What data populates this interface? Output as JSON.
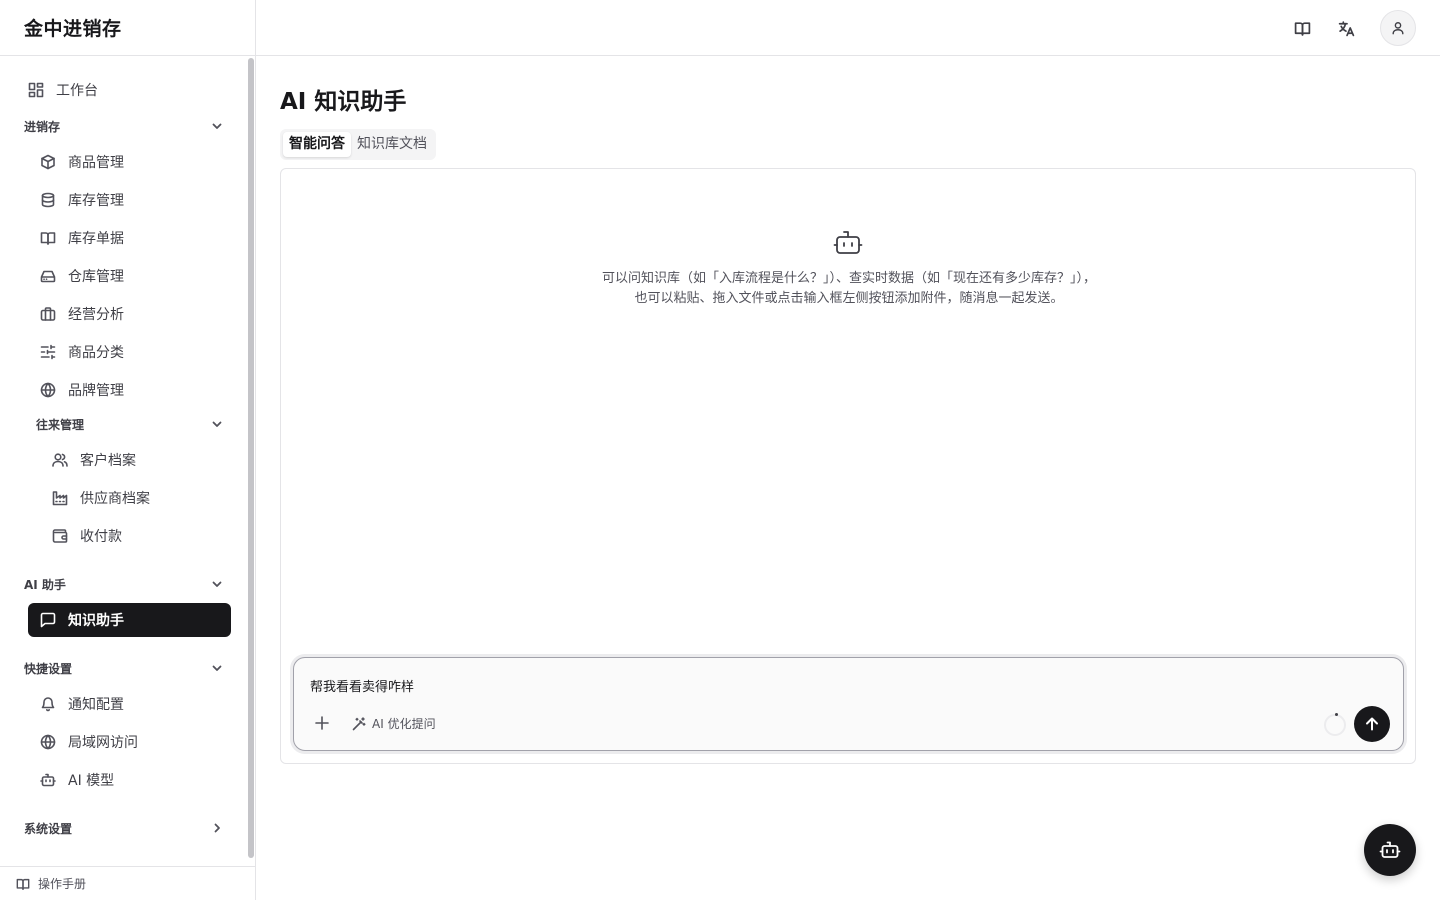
{
  "brand": "金中进销存",
  "sidebar": {
    "workbench": "工作台",
    "sections": {
      "inventory": "进销存",
      "partners": "往来管理",
      "ai": "AI 助手",
      "quick": "快捷设置",
      "system": "系统设置"
    },
    "items": {
      "products": "商品管理",
      "stock": "库存管理",
      "stock_docs": "库存单据",
      "warehouse": "仓库管理",
      "analytics": "经营分析",
      "categories": "商品分类",
      "brands": "品牌管理",
      "customers": "客户档案",
      "suppliers": "供应商档案",
      "payments": "收付款",
      "knowledge_assistant": "知识助手",
      "notifications": "通知配置",
      "lan_access": "局域网访问",
      "ai_model": "AI 模型"
    },
    "footer": "操作手册"
  },
  "main": {
    "title": "AI 知识助手",
    "tabs": [
      "智能问答",
      "知识库文档"
    ],
    "empty_hint_line1": "可以问知识库（如「入库流程是什么？」）、查实时数据（如「现在还有多少库存？」），",
    "empty_hint_line2": "也可以粘贴、拖入文件或点击输入框左侧按钮添加附件，随消息一起发送。",
    "composer": {
      "value": "帮我看看卖得咋样",
      "optimize_label": "AI 优化提问"
    }
  },
  "colors": {
    "accent": "#18181b",
    "border": "#e4e4e7",
    "muted_text": "#52525b"
  }
}
